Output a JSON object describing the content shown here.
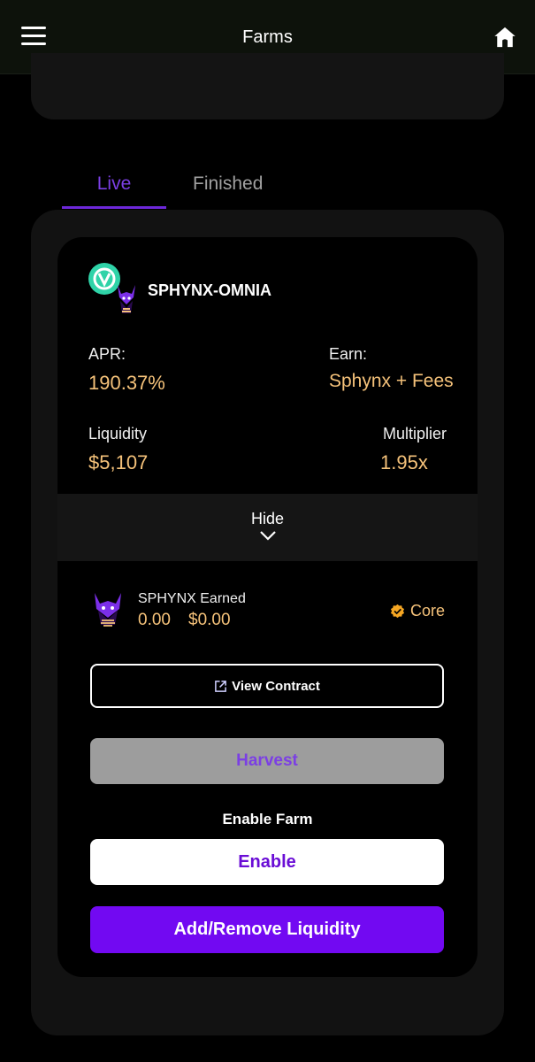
{
  "header": {
    "title": "Farms"
  },
  "tabs": [
    {
      "label": "Live",
      "active": true
    },
    {
      "label": "Finished",
      "active": false
    }
  ],
  "farm": {
    "pair_name": "SPHYNX-OMNIA",
    "apr_label": "APR:",
    "apr_value": "190.37%",
    "earn_label": "Earn:",
    "earn_value": "Sphynx + Fees",
    "liquidity_label": "Liquidity",
    "liquidity_value": "$5,107",
    "multiplier_label": "Multiplier",
    "multiplier_value": "1.95x",
    "hide_label": "Hide",
    "earned": {
      "title": "SPHYNX Earned",
      "amount": "0.00",
      "usd": "$0.00"
    },
    "core_label": "Core",
    "view_contract_label": "View Contract",
    "harvest_label": "Harvest",
    "enable_caption": "Enable Farm",
    "enable_label": "Enable",
    "liquidity_button_label": "Add/Remove Liquidity"
  },
  "colors": {
    "accent_purple": "#7209f2",
    "value_gold": "#f5c27a",
    "tab_active": "#7b3fe4",
    "omnia_teal": "#2fd3a8"
  },
  "icons": [
    "menu-icon",
    "home-icon",
    "omnia-token-icon",
    "sphynx-token-icon",
    "chevron-down-icon",
    "verified-badge-icon",
    "external-link-icon"
  ]
}
